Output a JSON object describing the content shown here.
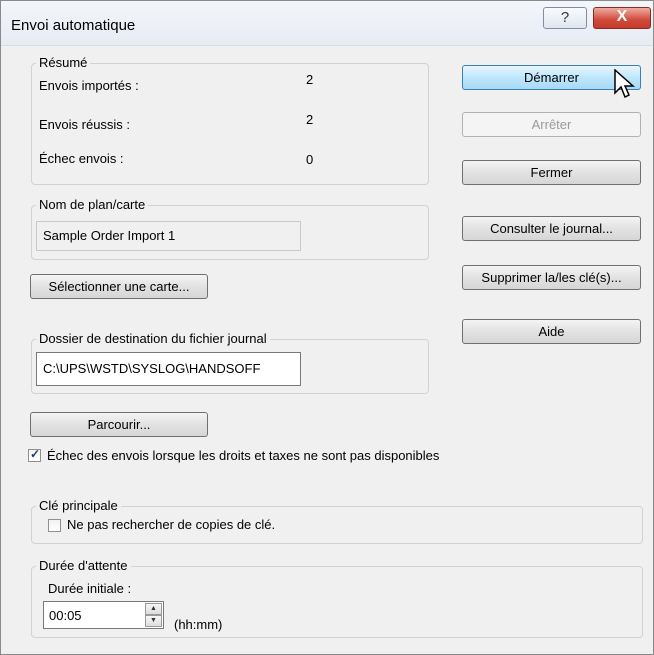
{
  "window": {
    "title": "Envoi automatique",
    "help_glyph": "?",
    "close_glyph": "X"
  },
  "summary": {
    "legend": "Résumé",
    "imported_label": "Envois importés :",
    "imported_value": "2",
    "success_label": "Envois réussis :",
    "success_value": "2",
    "failed_label": "Échec envois :",
    "failed_value": "0"
  },
  "map": {
    "legend": "Nom de plan/carte",
    "value": "Sample Order Import 1",
    "select_button": "Sélectionner une carte..."
  },
  "log_folder": {
    "legend": "Dossier de destination du fichier journal",
    "value": "C:\\UPS\\WSTD\\SYSLOG\\HANDSOFF",
    "browse_button": "Parcourir..."
  },
  "duties_checkbox": {
    "label": "Échec des envois lorsque les droits et taxes ne sont pas disponibles",
    "checked": true
  },
  "key": {
    "legend": "Clé principale",
    "checkbox_label": "Ne pas rechercher de copies de clé.",
    "checked": false
  },
  "wait": {
    "legend": "Durée d'attente",
    "initial_label": "Durée initiale :",
    "value": "00:05",
    "unit": "(hh:mm)"
  },
  "buttons": {
    "start": "Démarrer",
    "stop": "Arrêter",
    "close": "Fermer",
    "view_log": "Consulter le journal...",
    "delete_keys": "Supprimer la/les clé(s)...",
    "help": "Aide"
  }
}
